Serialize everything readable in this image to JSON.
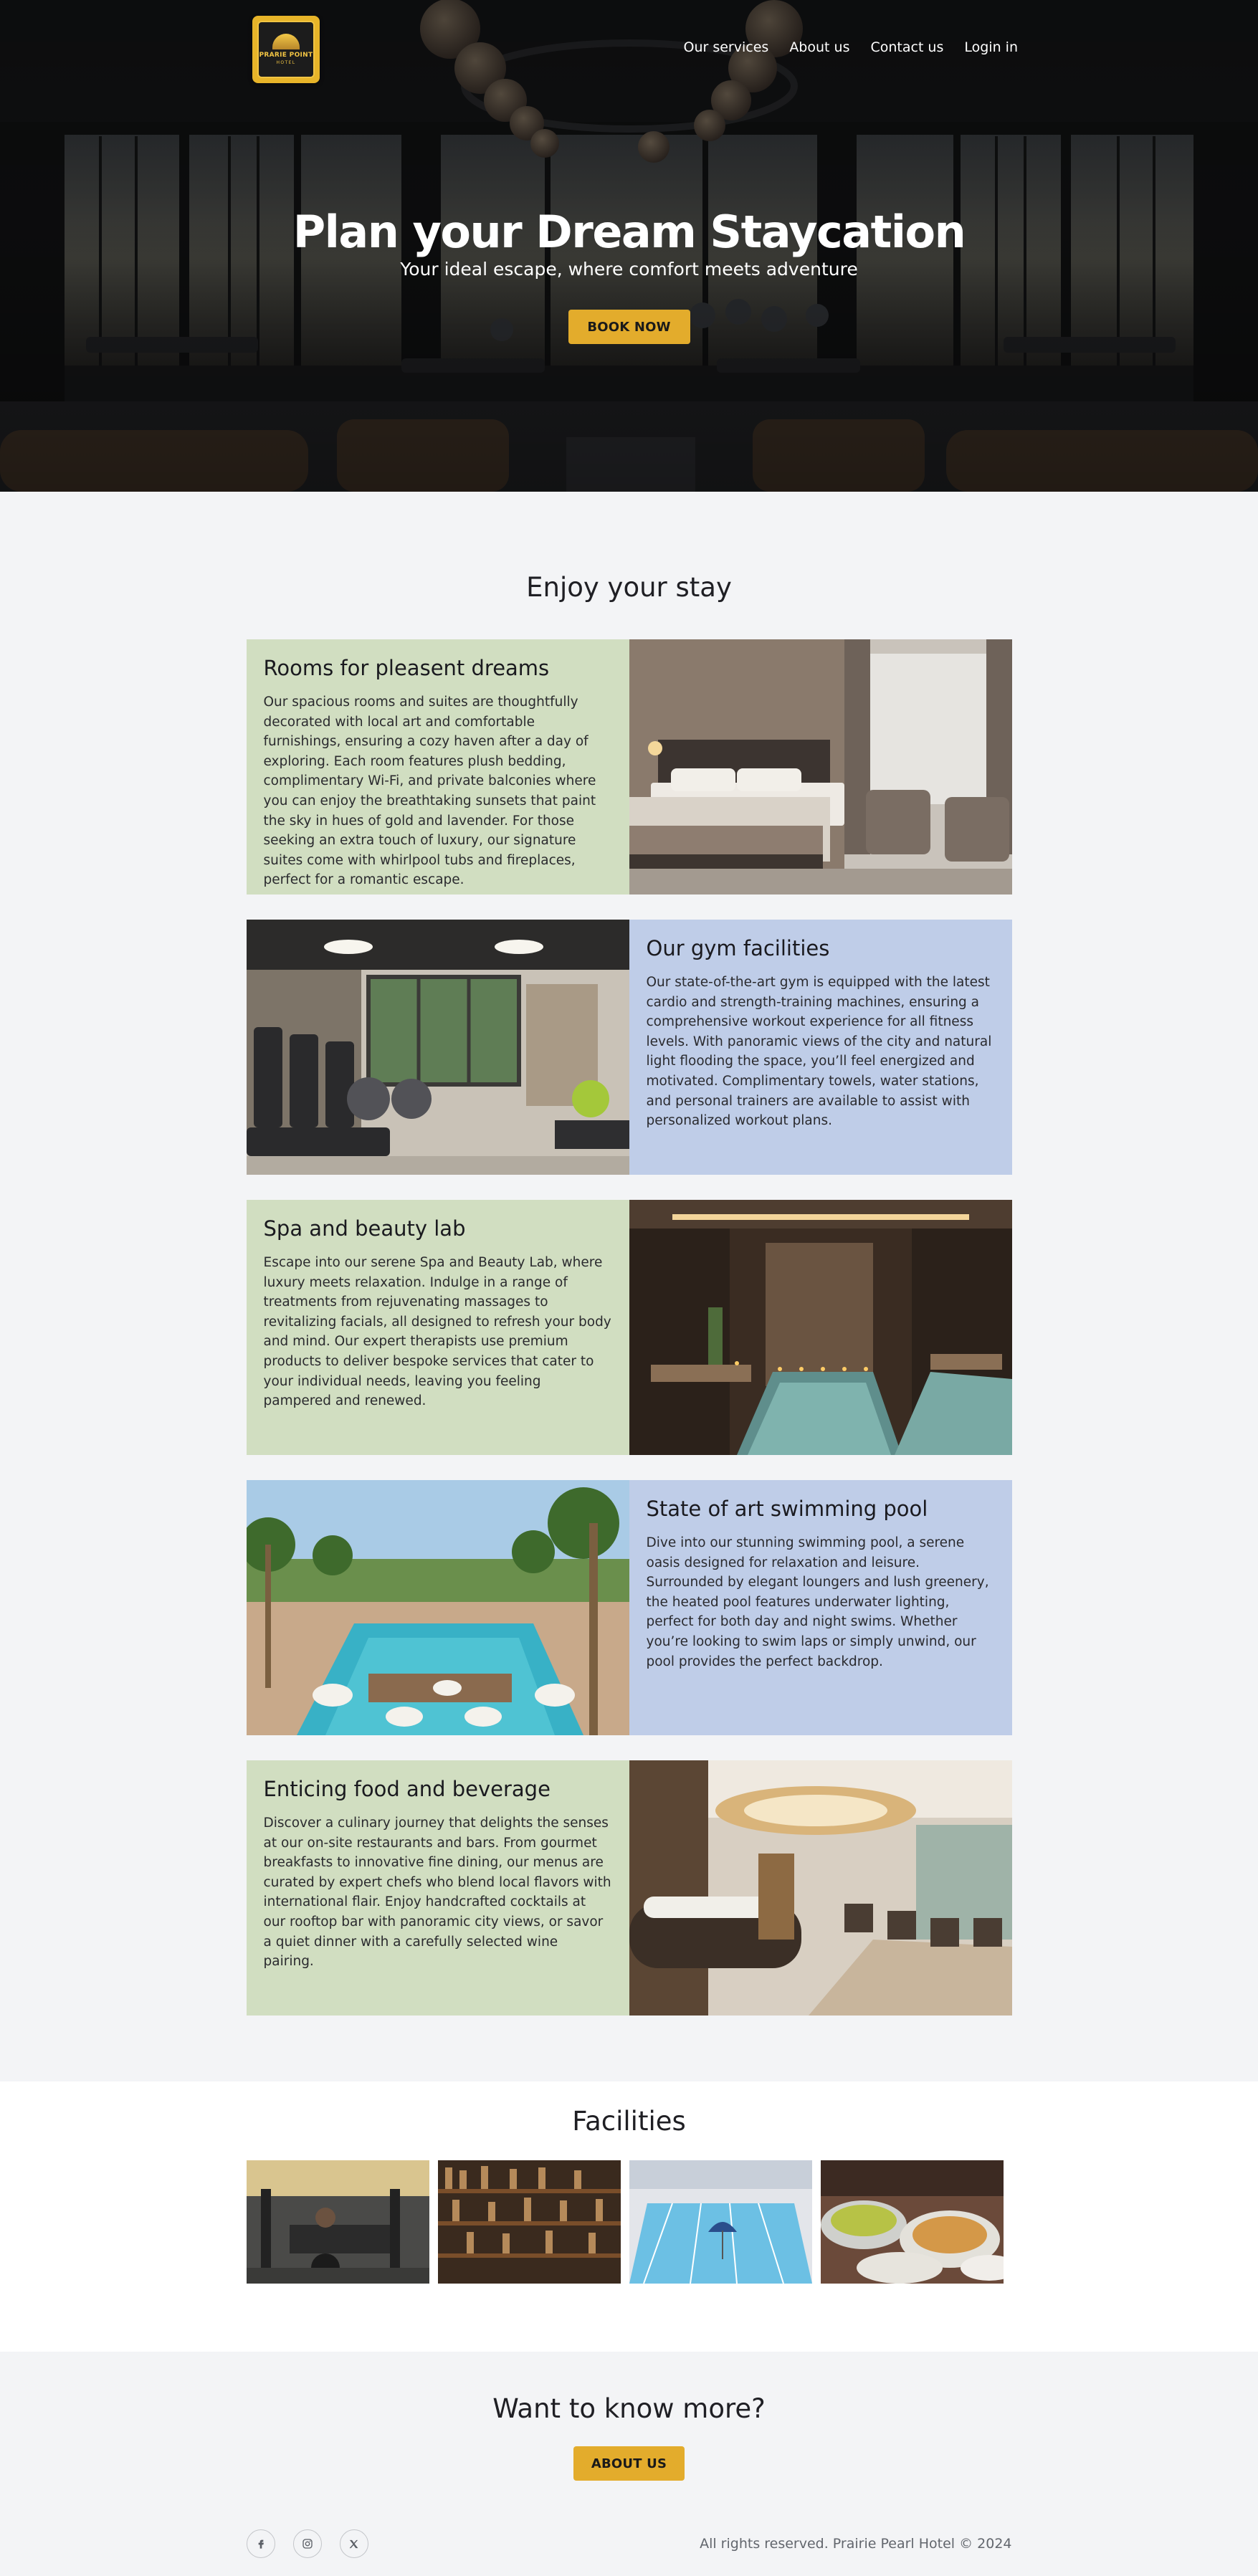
{
  "nav": {
    "logo": {
      "name": "PRARIE POINT",
      "sub": "HOTEL"
    },
    "links": [
      "Our services",
      "About us",
      "Contact us",
      "Login in"
    ]
  },
  "hero": {
    "title": "Plan your Dream Staycation",
    "subtitle": "Your ideal escape, where comfort meets adventure",
    "button": "BOOK NOW"
  },
  "stay": {
    "title": "Enjoy your stay",
    "features": [
      {
        "title": "Rooms for pleasent dreams",
        "text": "Our spacious rooms and suites are thoughtfully decorated with local art and comfortable furnishings, ensuring a cozy haven after a day of exploring. Each room features plush bedding, complimentary Wi-Fi, and private balconies where you can enjoy the breathtaking sunsets that paint the sky in hues of gold and lavender. For those seeking an extra touch of luxury, our signature suites come with whirlpool tubs and fireplaces, perfect for a romantic escape.",
        "image": "hotel-bedroom-photo"
      },
      {
        "title": "Our gym facilities",
        "text": "Our state-of-the-art gym is equipped with the latest cardio and strength-training machines, ensuring a comprehensive workout experience for all fitness levels. With panoramic views of the city and natural light flooding the space, you’ll feel energized and motivated. Complimentary towels, water stations, and personal trainers are available to assist with personalized workout plans.",
        "image": "gym-photo"
      },
      {
        "title": "Spa and beauty lab",
        "text": "Escape into our serene Spa and Beauty Lab, where luxury meets relaxation. Indulge in a range of treatments from rejuvenating massages to revitalizing facials, all designed to refresh your body and mind. Our expert therapists use premium products to deliver bespoke services that cater to your individual needs, leaving you feeling pampered and renewed.",
        "image": "spa-pool-photo"
      },
      {
        "title": "State of art swimming pool",
        "text": "Dive into our stunning swimming pool, a serene oasis designed for relaxation and leisure. Surrounded by elegant loungers and lush greenery, the heated pool features underwater lighting, perfect for both day and night swims. Whether you’re looking to swim laps or simply unwind, our pool provides the perfect backdrop.",
        "image": "outdoor-pool-photo"
      },
      {
        "title": "Enticing food and beverage",
        "text": "Discover a culinary journey that delights the senses at our on-site restaurants and bars. From gourmet breakfasts to innovative fine dining, our menus are curated by expert chefs who blend local flavors with international flair. Enjoy handcrafted cocktails at our rooftop bar with panoramic city views, or savor a quiet dinner with a carefully selected wine pairing.",
        "image": "restaurant-photo"
      }
    ]
  },
  "facilities": {
    "title": "Facilities",
    "images": [
      "weights-gym-photo",
      "bar-shelves-photo",
      "lap-pool-photo",
      "buffet-food-photo"
    ]
  },
  "cta": {
    "title": "Want to know more?",
    "button": "ABOUT US"
  },
  "footer": {
    "socials": [
      "facebook-icon",
      "instagram-icon",
      "x-icon"
    ],
    "copyright": "All rights reserved. Prairie Pearl Hotel © 2024"
  },
  "colors": {
    "accent": "#e3ac2c",
    "green_panel": "#d1dec1",
    "blue_panel": "#bfcde8",
    "page_bg": "#f3f4f6"
  }
}
